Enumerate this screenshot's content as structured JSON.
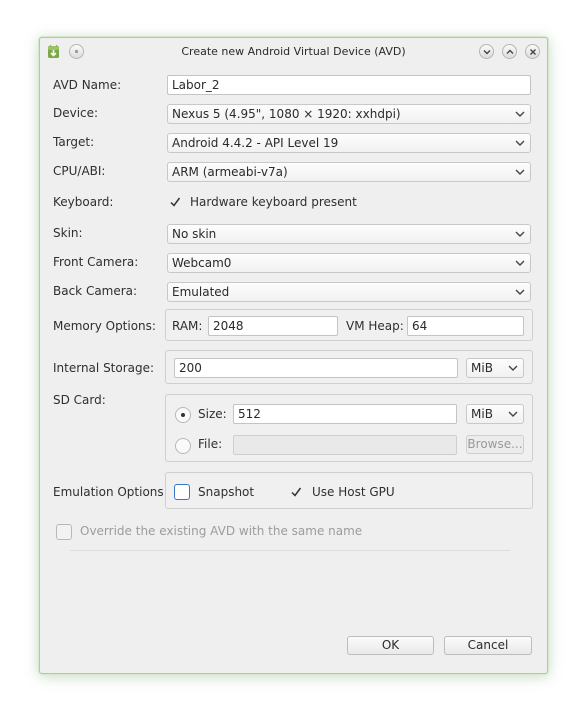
{
  "window": {
    "title": "Create new Android Virtual Device (AVD)"
  },
  "form": {
    "avd_name_label": "AVD Name:",
    "avd_name_value": "Labor_2",
    "device_label": "Device:",
    "device_value": "Nexus 5 (4.95\", 1080 × 1920: xxhdpi)",
    "target_label": "Target:",
    "target_value": "Android 4.4.2 - API Level 19",
    "cpu_label": "CPU/ABI:",
    "cpu_value": "ARM (armeabi-v7a)",
    "keyboard_label": "Keyboard:",
    "keyboard_check_label": "Hardware keyboard present",
    "keyboard_checked": true,
    "skin_label": "Skin:",
    "skin_value": "No skin",
    "front_camera_label": "Front Camera:",
    "front_camera_value": "Webcam0",
    "back_camera_label": "Back Camera:",
    "back_camera_value": "Emulated",
    "memory_label": "Memory Options:",
    "ram_label": "RAM:",
    "ram_value": "2048",
    "vmheap_label": "VM Heap:",
    "vmheap_value": "64",
    "storage_label": "Internal Storage:",
    "storage_value": "200",
    "storage_unit": "MiB",
    "sdcard_label": "SD Card:",
    "sd_size_label": "Size:",
    "sd_size_value": "512",
    "sd_size_unit": "MiB",
    "sd_file_label": "File:",
    "sd_file_value": "",
    "browse_label": "Browse...",
    "emulation_label": "Emulation Options:",
    "snapshot_label": "Snapshot",
    "snapshot_checked": false,
    "hostgpu_label": "Use Host GPU",
    "hostgpu_checked": true,
    "override_label": "Override the existing AVD with the same name",
    "override_checked": false
  },
  "buttons": {
    "ok": "OK",
    "cancel": "Cancel"
  },
  "icons": [
    "android-download-icon",
    "menu-icon",
    "minimize-icon",
    "maximize-icon",
    "close-icon",
    "chevron-down-icon",
    "checkmark-icon"
  ]
}
